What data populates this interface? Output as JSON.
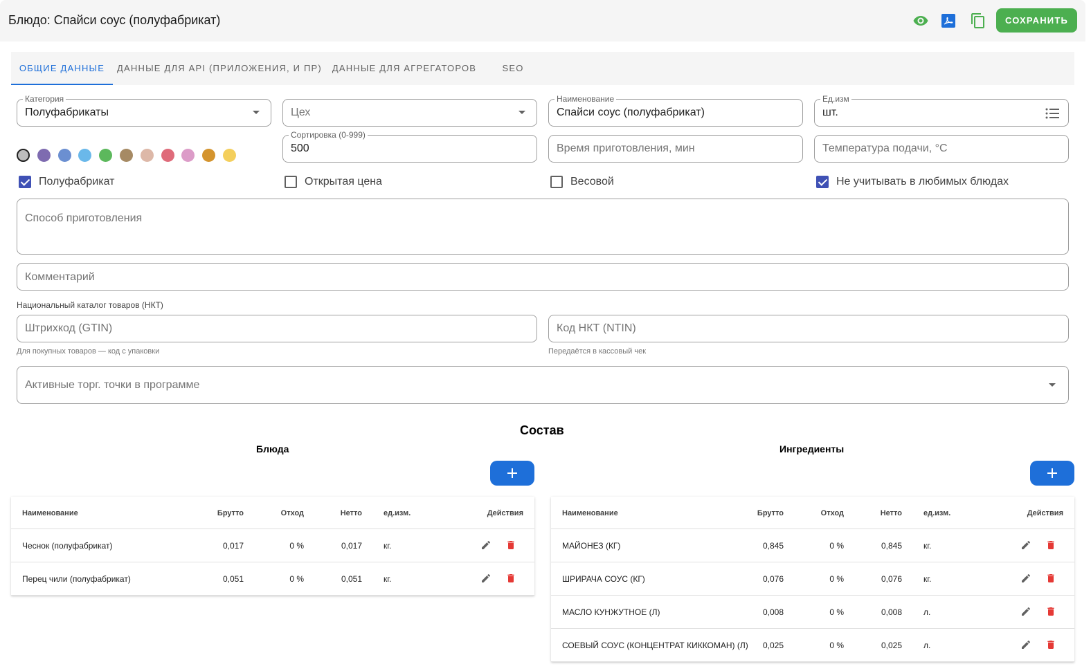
{
  "header": {
    "title": "Блюдо: Спайси соус (полуфабрикат)",
    "save_label": "СОХРАНИТЬ",
    "icons": [
      "eye-icon",
      "pdf-icon",
      "copy-icon"
    ]
  },
  "tabs": [
    {
      "label": "ОБЩИЕ ДАННЫЕ",
      "active": true
    },
    {
      "label": "ДАННЫЕ ДЛЯ API (ПРИЛОЖЕНИЯ, И ПР)",
      "active": false
    },
    {
      "label": "ДАННЫЕ ДЛЯ АГРЕГАТОРОВ",
      "active": false
    },
    {
      "label": "SEO",
      "active": false
    }
  ],
  "form": {
    "category": {
      "label": "Категория",
      "value": "Полуфабрикаты"
    },
    "workshop": {
      "placeholder": "Цех"
    },
    "name": {
      "label": "Наименование",
      "value": "Спайси соус (полуфабрикат)"
    },
    "unit": {
      "label": "Ед.изм",
      "value": "шт."
    },
    "sort": {
      "label": "Сортировка (0-999)",
      "value": "500"
    },
    "cook_time": {
      "placeholder": "Время приготовления, мин"
    },
    "serve_temp": {
      "placeholder": "Температура подачи, °C"
    },
    "colors": [
      "#bdbdbd",
      "#7e6bb0",
      "#6b8fd1",
      "#6ab8ea",
      "#5cb85c",
      "#a68a64",
      "#ddb8a8",
      "#df6b7a",
      "#dc9cc8",
      "#d4942e",
      "#f4cf5c"
    ],
    "checkboxes": [
      {
        "label": "Полуфабрикат",
        "checked": true
      },
      {
        "label": "Открытая цена",
        "checked": false
      },
      {
        "label": "Весовой",
        "checked": false
      },
      {
        "label": "Не учитывать в любимых блюдах",
        "checked": true
      }
    ],
    "method": {
      "placeholder": "Способ приготовления"
    },
    "comment": {
      "placeholder": "Комментарий"
    },
    "nkt_title": "Национальный каталог товаров (НКТ)",
    "gtin": {
      "placeholder": "Штрихкод (GTIN)",
      "hint": "Для покупных товаров — код с упаковки"
    },
    "ntin": {
      "placeholder": "Код НКТ (NTIN)",
      "hint": "Передаётся в кассовый чек"
    },
    "outlets": {
      "placeholder": "Активные торг. точки в программе"
    }
  },
  "composition": {
    "title": "Состав",
    "columns": [
      "Наименование",
      "Брутто",
      "Отход",
      "Нетто",
      "ед.изм.",
      "Действия"
    ],
    "dishes": {
      "title": "Блюда",
      "rows": [
        {
          "name": "Чеснок (полуфабрикат)",
          "gross": "0,017",
          "waste": "0 %",
          "net": "0,017",
          "unit": "кг."
        },
        {
          "name": "Перец чили (полуфабрикат)",
          "gross": "0,051",
          "waste": "0 %",
          "net": "0,051",
          "unit": "кг."
        }
      ]
    },
    "ingredients": {
      "title": "Ингредиенты",
      "rows": [
        {
          "name": "МАЙОНЕЗ (КГ)",
          "gross": "0,845",
          "waste": "0 %",
          "net": "0,845",
          "unit": "кг."
        },
        {
          "name": "ШРИРАЧА СОУС (КГ)",
          "gross": "0,076",
          "waste": "0 %",
          "net": "0,076",
          "unit": "кг."
        },
        {
          "name": "МАСЛО КУНЖУТНОЕ (Л)",
          "gross": "0,008",
          "waste": "0 %",
          "net": "0,008",
          "unit": "л."
        },
        {
          "name": "СОЕВЫЙ СОУС (КОНЦЕНТРАТ КИККОМАН) (Л)",
          "gross": "0,025",
          "waste": "0 %",
          "net": "0,025",
          "unit": "л."
        }
      ]
    }
  },
  "theme": {
    "accent": "#1e6fd9",
    "save": "#4caf50",
    "checkbox": "#3f51b5",
    "delete": "#e53935"
  }
}
